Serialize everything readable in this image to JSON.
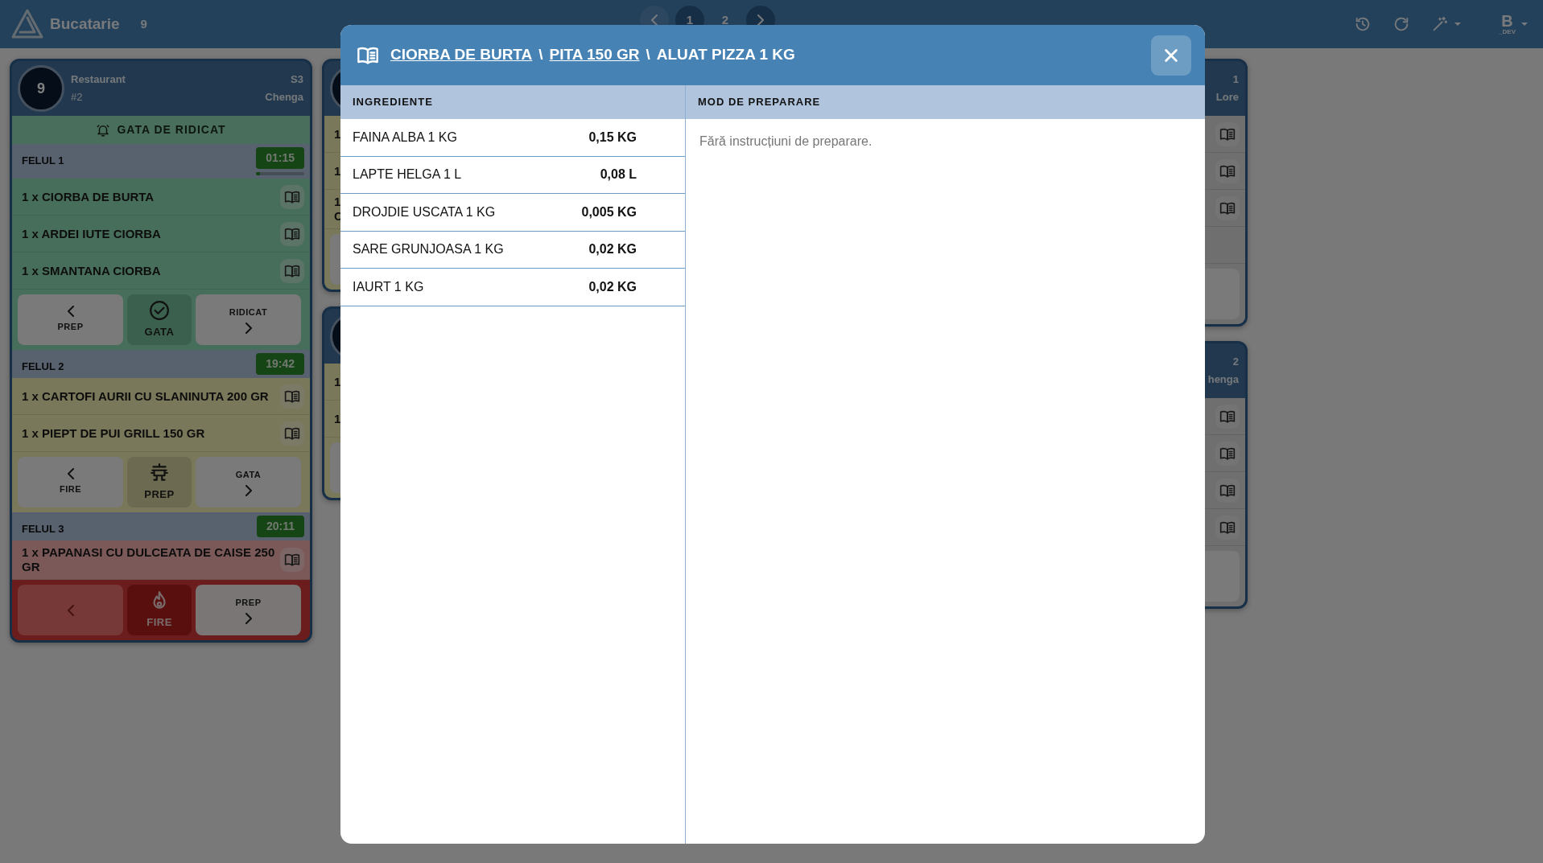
{
  "app": {
    "title": "Bucatarie",
    "count": "9"
  },
  "pagination": {
    "pages": [
      {
        "label": "1",
        "selected": true
      },
      {
        "label": "2",
        "selected": false
      }
    ]
  },
  "user": {
    "initial": "B",
    "tag": "_DEV"
  },
  "columns": [
    {
      "tickets": [
        {
          "header": {
            "badge": true,
            "table": "9",
            "area": "Restaurant",
            "order": "#2",
            "number": "S3",
            "waiter": "Chenga"
          },
          "banner": "GATA DE RIDICAT",
          "courses": [
            {
              "title": "FELUL 1",
              "timer": "01:15",
              "progress": {
                "level": 0.08
              },
              "kind": "ready",
              "items": [
                {
                  "kind": "dish",
                  "text": "1 x CIORBA DE BURTA"
                },
                {
                  "kind": "dish",
                  "text": "1 x ARDEI IUTE CIORBA"
                },
                {
                  "kind": "dish",
                  "text": "1 x SMANTANA CIORBA"
                }
              ],
              "actions": {
                "prev": "PREP",
                "current": "GATA",
                "next": "RIDICAT"
              }
            },
            {
              "title": "FELUL 2",
              "timer": "19:42",
              "kind": "prep",
              "items": [
                {
                  "kind": "dish",
                  "text": "1 x CARTOFI AURII CU SLANINUTA 200 GR"
                },
                {
                  "kind": "dish",
                  "text": "1 x PIEPT DE PUI GRILL 150 GR"
                }
              ],
              "actions": {
                "prev": "FIRE",
                "current": "PREP",
                "next": "GATA"
              }
            },
            {
              "title": "FELUL 3",
              "timer": "20:11",
              "kind": "fire",
              "items": [
                {
                  "kind": "dish",
                  "text": "1 x PAPANASI CU DULCEATA DE CAISE 250 GR"
                }
              ],
              "actions": {
                "current": "FIRE",
                "next": "PREP"
              }
            }
          ]
        }
      ]
    },
    {
      "tickets": [
        {
          "header": {
            "badge": true
          },
          "courses": [
            {
              "kind": "prep",
              "items": [
                {
                  "kind": "line",
                  "text": "1"
                },
                {
                  "kind": "line",
                  "text": "1"
                },
                {
                  "kind": "line",
                  "text": "1 C"
                }
              ],
              "button_row": true
            }
          ]
        },
        {
          "header": {
            "badge": true
          },
          "courses": [
            {
              "kind": "prep",
              "items": [
                {
                  "kind": "line",
                  "text": "1"
                },
                {
                  "kind": "line",
                  "text": "1"
                }
              ],
              "button_row": true
            }
          ]
        }
      ]
    },
    {
      "tickets": [
        {
          "header": {
            "number": "1",
            "waiter": "Lore"
          },
          "courses": [
            {
              "kind": "neutral",
              "items": [
                {
                  "kind": "dish"
                },
                {
                  "kind": "dish"
                },
                {
                  "kind": "dish"
                },
                {
                  "kind": "blank"
                }
              ],
              "button_row": true
            }
          ]
        },
        {
          "header": {
            "number": "2",
            "waiter": "henga"
          },
          "courses": [
            {
              "kind": "neutral",
              "items": [
                {
                  "kind": "dish"
                },
                {
                  "kind": "dish"
                },
                {
                  "kind": "dish"
                },
                {
                  "kind": "dish"
                }
              ],
              "button_row": true
            }
          ]
        }
      ]
    }
  ],
  "modal": {
    "breadcrumb": [
      {
        "label": "CIORBA DE BURTA",
        "link": true
      },
      {
        "label": "PITA 150 GR",
        "link": true
      },
      {
        "label": "ALUAT PIZZA 1 KG",
        "link": false
      }
    ],
    "separator": "\\",
    "ingredients_heading": "INGREDIENTE",
    "method_heading": "MOD DE PREPARARE",
    "ingredients": [
      {
        "name": "FAINA ALBA 1 KG",
        "qty": "0,15 KG"
      },
      {
        "name": "LAPTE HELGA 1 L",
        "qty": "0,08 L"
      },
      {
        "name": "DROJDIE USCATA 1 KG",
        "qty": "0,005 KG"
      },
      {
        "name": "SARE GRUNJOASA 1 KG",
        "qty": "0,02 KG"
      },
      {
        "name": "IAURT 1 KG",
        "qty": "0,02 KG"
      }
    ],
    "method_text": "Fără instrucțiuni de preparare."
  }
}
